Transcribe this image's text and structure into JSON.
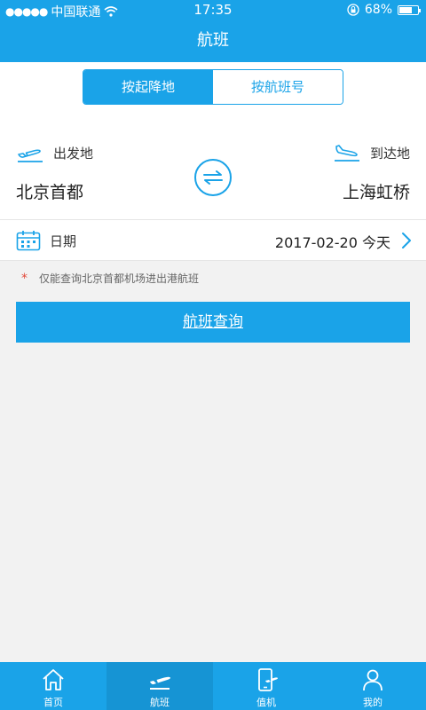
{
  "status_bar": {
    "carrier": "中国联通",
    "time": "17:35",
    "battery": "68%",
    "battery_level": 0.68
  },
  "nav": {
    "title": "航班"
  },
  "segments": [
    {
      "label": "按起降地",
      "selected": true
    },
    {
      "label": "按航班号",
      "selected": false
    }
  ],
  "route": {
    "departure_label": "出发地",
    "arrival_label": "到达地",
    "departure_city": "北京首都",
    "arrival_city": "上海虹桥"
  },
  "date": {
    "label": "日期",
    "value": "2017-02-20 今天"
  },
  "notice": {
    "marker": "*",
    "text": "仅能查询北京首都机场进出港航班"
  },
  "search_button": "航班查询",
  "tabs": [
    {
      "label": "首页",
      "icon": "home-icon",
      "active": false
    },
    {
      "label": "航班",
      "icon": "plane-icon",
      "active": true
    },
    {
      "label": "值机",
      "icon": "checkin-phone-icon",
      "active": false
    },
    {
      "label": "我的",
      "icon": "user-icon",
      "active": false
    }
  ],
  "colors": {
    "primary": "#1aa3e8",
    "tab_active": "#1694d4",
    "notice_marker": "#e24a3b",
    "background": "#f2f2f2"
  },
  "icons": {
    "departure": "plane-takeoff-icon",
    "arrival": "plane-landing-icon",
    "swap": "swap-arrows-icon",
    "calendar": "calendar-icon",
    "chevron": "chevron-right-icon",
    "wifi": "wifi-icon",
    "lock": "orientation-lock-icon",
    "battery": "battery-icon"
  }
}
